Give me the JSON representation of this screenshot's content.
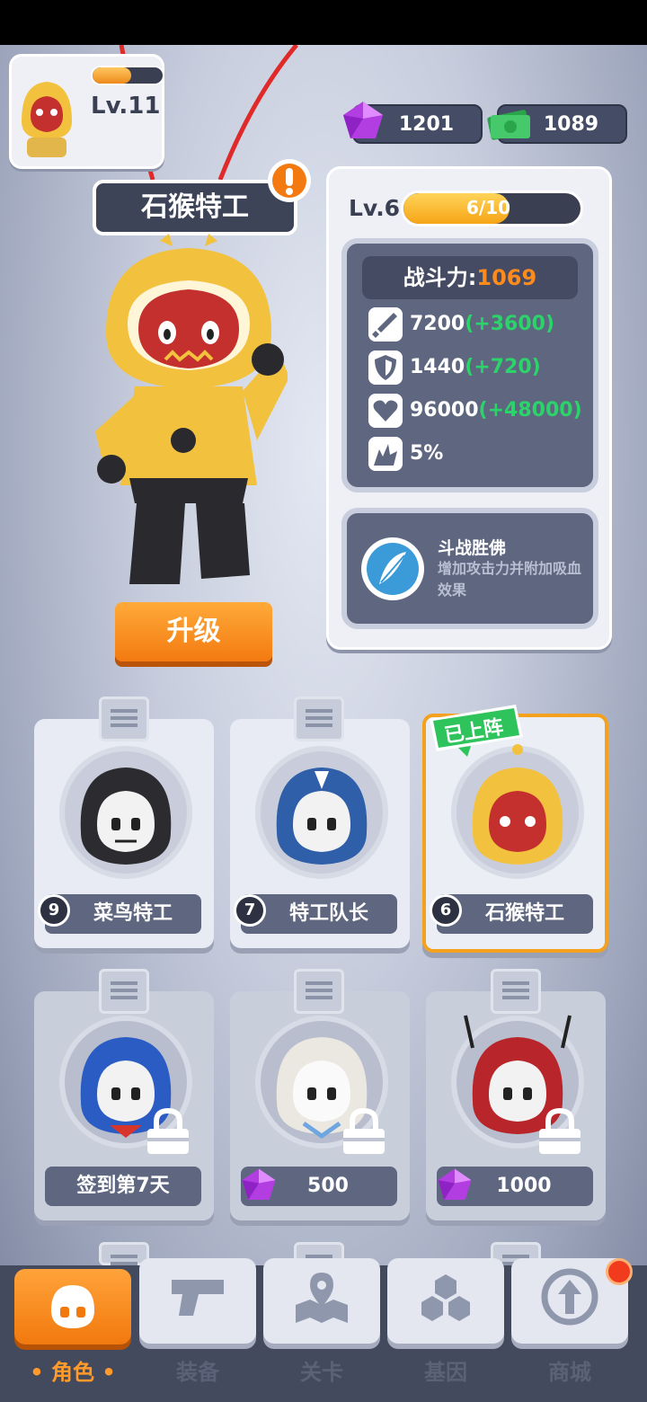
{
  "player": {
    "level": "Lv.11",
    "xp_fraction": 0.55
  },
  "currency": {
    "gems": "1201",
    "cash": "1089"
  },
  "character": {
    "name": "石猴特工"
  },
  "upgrade_button": "升级",
  "stats": {
    "level": "Lv.6",
    "progress": "6/10",
    "progress_fraction": 0.6,
    "power_label": "战斗力:",
    "power_value": "1069",
    "attack": {
      "value": "7200",
      "bonus": "(+3600)",
      "icon": "sword-icon"
    },
    "defense": {
      "value": "1440",
      "bonus": "(+720)",
      "icon": "shield-icon"
    },
    "health": {
      "value": "96000",
      "bonus": "(+48000)",
      "icon": "heart-icon"
    },
    "crit": {
      "value": "5%",
      "icon": "crit-icon"
    }
  },
  "skill": {
    "name": "斗战胜佛",
    "description": "增加攻击力并附加吸血效果",
    "icon": "feather-skill-icon"
  },
  "cards": [
    {
      "level": "9",
      "name": "菜鸟特工",
      "hood": "#2c2c30",
      "state": "owned"
    },
    {
      "level": "7",
      "name": "特工队长",
      "hood": "#2e5fa8",
      "state": "owned"
    },
    {
      "level": "6",
      "name": "石猴特工",
      "hood": "#f2c13d",
      "state": "selected",
      "tag": "已上阵"
    },
    {
      "name": "签到第7天",
      "hood": "#2a5cc4",
      "state": "locked"
    },
    {
      "price": "500",
      "hood": "#ebe7e1",
      "state": "locked"
    },
    {
      "price": "1000",
      "hood": "#b8252a",
      "state": "locked"
    }
  ],
  "nav": [
    {
      "label": "角色",
      "icon": "skull-icon",
      "active": true
    },
    {
      "label": "装备",
      "icon": "gun-icon"
    },
    {
      "label": "关卡",
      "icon": "map-pin-icon"
    },
    {
      "label": "基因",
      "icon": "hexagon-icon"
    },
    {
      "label": "商城",
      "icon": "shop-icon"
    }
  ],
  "colors": {
    "accent": "#f58a1a",
    "bonus": "#2bd36a",
    "panel": "#5f6780"
  }
}
